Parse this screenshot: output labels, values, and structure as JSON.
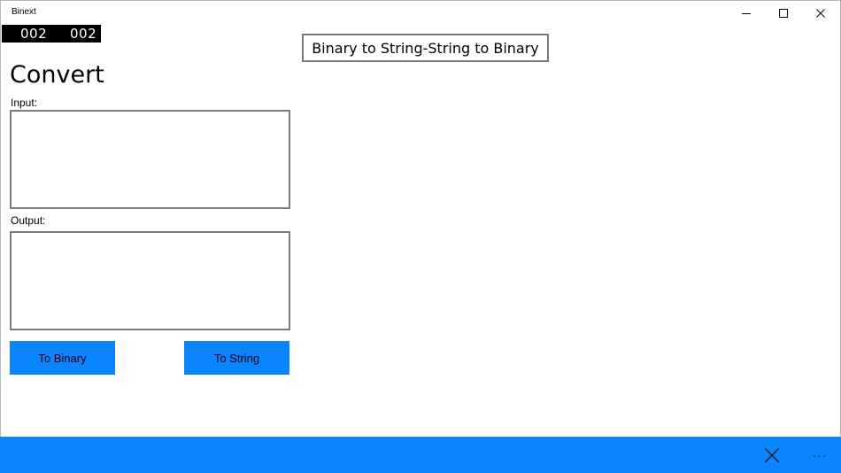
{
  "window": {
    "title": "Binext"
  },
  "counters": {
    "left": "002",
    "right": "002"
  },
  "header": {
    "banner": "Binary to String-String to Binary"
  },
  "main": {
    "heading": "Convert",
    "input_label": "Input:",
    "input_value": "",
    "output_label": "Output:",
    "output_value": ""
  },
  "buttons": {
    "to_binary": "To Binary",
    "to_string": "To String"
  },
  "app_bar": {
    "more_label": "···",
    "close_icon": "close-icon"
  },
  "colors": {
    "accent": "#0a84ff",
    "counter_bg": "#000000",
    "border": "#7a7a7a"
  }
}
